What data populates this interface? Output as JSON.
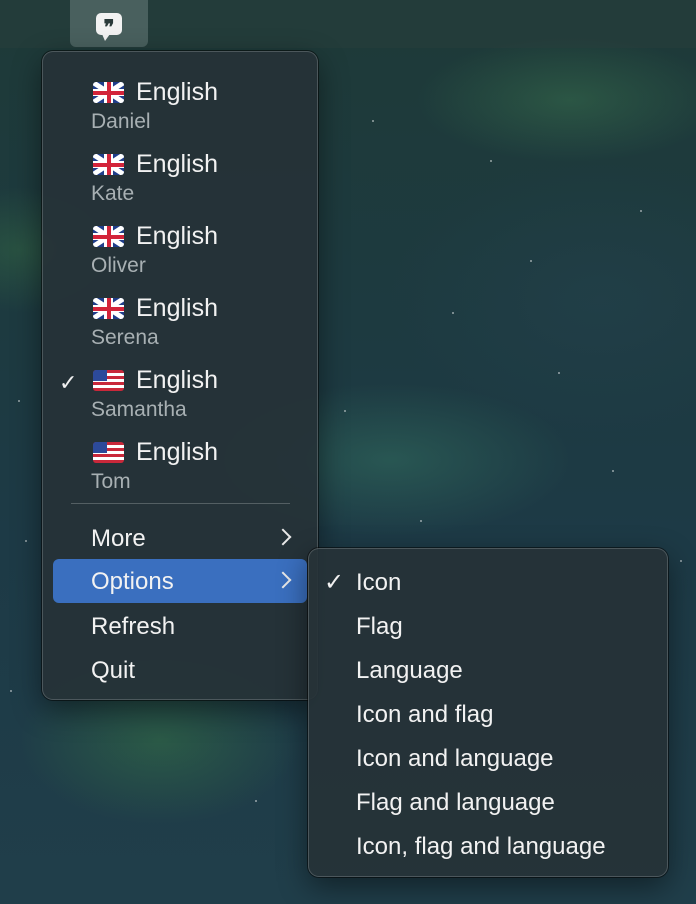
{
  "menubar": {
    "status_icon": "quote-bubble-icon",
    "status_glyph": "❞"
  },
  "voices": [
    {
      "language": "English",
      "name": "Daniel",
      "flag": "uk",
      "checked": false
    },
    {
      "language": "English",
      "name": "Kate",
      "flag": "uk",
      "checked": false
    },
    {
      "language": "English",
      "name": "Oliver",
      "flag": "uk",
      "checked": false
    },
    {
      "language": "English",
      "name": "Serena",
      "flag": "uk",
      "checked": false
    },
    {
      "language": "English",
      "name": "Samantha",
      "flag": "us",
      "checked": true
    },
    {
      "language": "English",
      "name": "Tom",
      "flag": "us",
      "checked": false
    }
  ],
  "check_glyph": "✓",
  "menu": {
    "more_label": "More",
    "options_label": "Options",
    "refresh_label": "Refresh",
    "quit_label": "Quit"
  },
  "options_submenu": {
    "items": [
      {
        "label": "Icon",
        "checked": true
      },
      {
        "label": "Flag",
        "checked": false
      },
      {
        "label": "Language",
        "checked": false
      },
      {
        "label": "Icon and flag",
        "checked": false
      },
      {
        "label": "Icon and language",
        "checked": false
      },
      {
        "label": "Flag and language",
        "checked": false
      },
      {
        "label": "Icon, flag and language",
        "checked": false
      }
    ]
  },
  "colors": {
    "highlight": "#3a6fbf",
    "menu_bg": "#263237",
    "secondary_text": "#a8b0b3"
  }
}
